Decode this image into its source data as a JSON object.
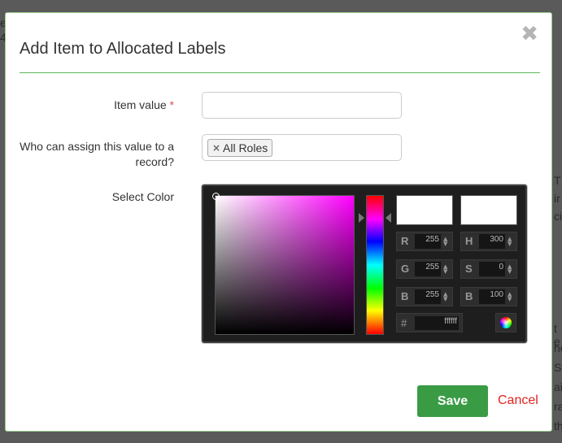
{
  "background": {
    "frags": [
      "e",
      "4",
      "T",
      "ir",
      "ci",
      "t e",
      "he",
      "Si",
      "ai",
      "ra",
      "th"
    ]
  },
  "modal": {
    "title": "Add Item to Allocated Labels",
    "close_icon": "close-icon",
    "accent_color": "#5cb85c",
    "fields": {
      "item_value_label": "Item value",
      "required_mark": "*",
      "item_value": "",
      "who_label": "Who can assign this value to a record?",
      "role_chip": "All Roles",
      "select_color_label": "Select Color"
    },
    "color_picker": {
      "base_hue_color": "#ff00ff",
      "R": {
        "label": "R",
        "value": "255"
      },
      "G": {
        "label": "G",
        "value": "255"
      },
      "B": {
        "label": "B",
        "value": "255"
      },
      "H": {
        "label": "H",
        "value": "300"
      },
      "S": {
        "label": "S",
        "value": "0"
      },
      "V": {
        "label": "B",
        "value": "100"
      },
      "hex": {
        "label": "#",
        "value": "ffffff"
      },
      "wheel_icon": "color-wheel-icon"
    },
    "actions": {
      "save_label": "Save",
      "cancel_label": "Cancel",
      "save_color": "#3a9b45",
      "cancel_color": "#e0241f"
    }
  }
}
